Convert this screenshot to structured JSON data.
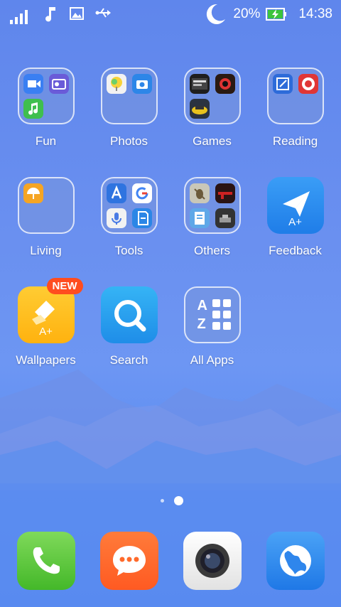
{
  "status_bar": {
    "battery": "20%",
    "time": "14:38",
    "battery_level": 0.2
  },
  "apps": [
    {
      "label": "Fun"
    },
    {
      "label": "Photos"
    },
    {
      "label": "Games"
    },
    {
      "label": "Reading"
    },
    {
      "label": "Living"
    },
    {
      "label": "Tools"
    },
    {
      "label": "Others"
    },
    {
      "label": "Feedback"
    },
    {
      "label": "Wallpapers",
      "badge": "NEW"
    },
    {
      "label": "Search"
    },
    {
      "label": "All Apps"
    }
  ],
  "feedback_icon_text": "A+",
  "wallpapers_icon_text": "A+",
  "allapps_icon_letters": {
    "top": "A",
    "bottom": "Z"
  },
  "pager": {
    "pages": 2,
    "current": 2
  },
  "dock": [
    {
      "name": "phone-app-icon"
    },
    {
      "name": "messages-app-icon"
    },
    {
      "name": "camera-app-icon"
    },
    {
      "name": "browser-app-icon"
    }
  ],
  "colors": {
    "phone": "#5fc93a",
    "messages": "#ff6a2b",
    "camera": "#f2f2f2",
    "browser": "#3a8cf3",
    "badge": "#ff4d1f"
  }
}
